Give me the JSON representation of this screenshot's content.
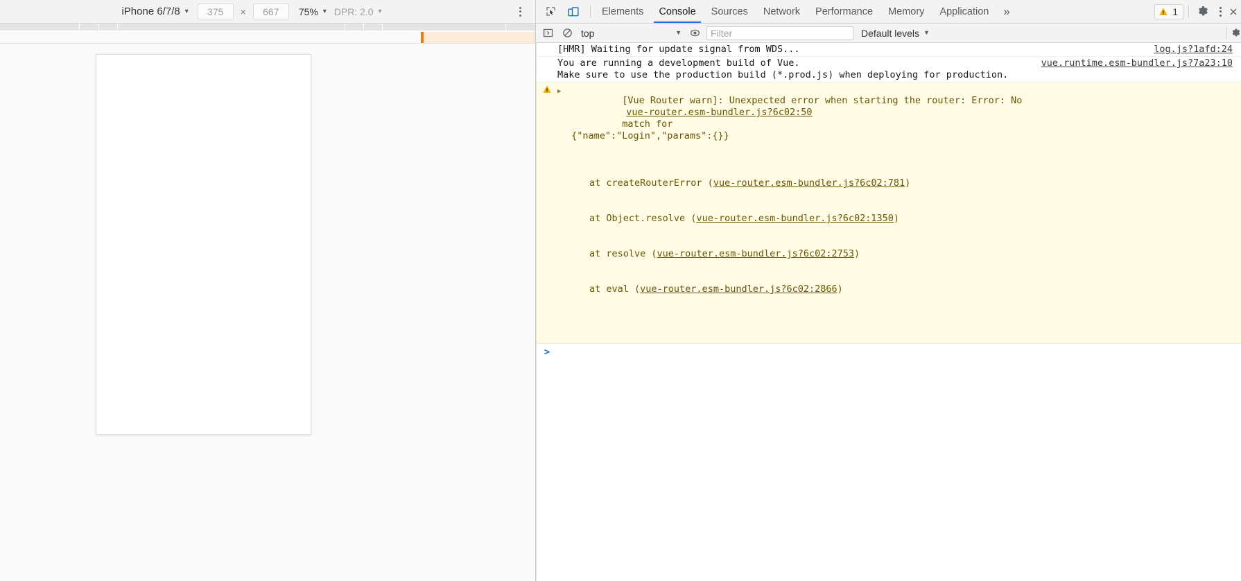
{
  "device_toolbar": {
    "device_name": "iPhone 6/7/8",
    "width": "375",
    "height": "667",
    "times_symbol": "×",
    "zoom": "75%",
    "dpr": "DPR: 2.0",
    "menu_icon": "kebab-menu-icon",
    "device_caret": "▼",
    "zoom_caret": "▼",
    "dpr_caret": "▼"
  },
  "devtools_tabbar": {
    "inspect_icon": "inspect-element-icon",
    "device_toggle_icon": "device-toolbar-icon",
    "tabs": [
      {
        "label": "Elements",
        "active": false
      },
      {
        "label": "Console",
        "active": true
      },
      {
        "label": "Sources",
        "active": false
      },
      {
        "label": "Network",
        "active": false
      },
      {
        "label": "Performance",
        "active": false
      },
      {
        "label": "Memory",
        "active": false
      },
      {
        "label": "Application",
        "active": false
      }
    ],
    "more_tabs": "»",
    "warning_icon": "warning-triangle-icon",
    "warning_count": "1",
    "settings_icon": "gear-icon",
    "main_menu_icon": "kebab-menu-icon",
    "close_icon": "close-icon"
  },
  "console_toolbar": {
    "sidebar_icon": "console-sidebar-icon",
    "clear_icon": "clear-console-icon",
    "context": "top",
    "context_caret": "▼",
    "eye_icon": "live-expression-eye-icon",
    "filter_placeholder": "Filter",
    "filter_value": "",
    "levels": "Default levels",
    "levels_caret": "▼",
    "settings_icon": "console-settings-gear-icon"
  },
  "console_messages": [
    {
      "kind": "log",
      "text": "[HMR] Waiting for update signal from WDS...",
      "source": "log.js?1afd:24"
    },
    {
      "kind": "log",
      "text": "You are running a development build of Vue.\nMake sure to use the production build (*.prod.js) when deploying for production.",
      "source": "vue.runtime.esm-bundler.js?7a23:10"
    }
  ],
  "warning_message": {
    "expander": "▶",
    "icon": "warning-triangle-icon",
    "text_head": "[Vue Router warn]: Unexpected error when starting the router: Error: No",
    "text_rest": "match for\n {\"name\":\"Login\",\"params\":{}}",
    "source": "vue-router.esm-bundler.js?6c02:50",
    "stack": [
      {
        "at": "at createRouterError (",
        "link": "vue-router.esm-bundler.js?6c02:781",
        "close": ")"
      },
      {
        "at": "at Object.resolve (",
        "link": "vue-router.esm-bundler.js?6c02:1350",
        "close": ")"
      },
      {
        "at": "at resolve (",
        "link": "vue-router.esm-bundler.js?6c02:2753",
        "close": ")"
      },
      {
        "at": "at eval (",
        "link": "vue-router.esm-bundler.js?6c02:2866",
        "close": ")"
      }
    ]
  },
  "console_prompt": {
    "chevron": ">",
    "value": ""
  },
  "colors": {
    "accent": "#1a73e8",
    "warning_bg": "#fffbe5",
    "warning_text": "#6b5600",
    "warning_icon": "#f0b400",
    "media_query_band": "#fdecd9",
    "media_query_marker": "#e8820c",
    "toolbar_bg": "#f3f3f3"
  }
}
